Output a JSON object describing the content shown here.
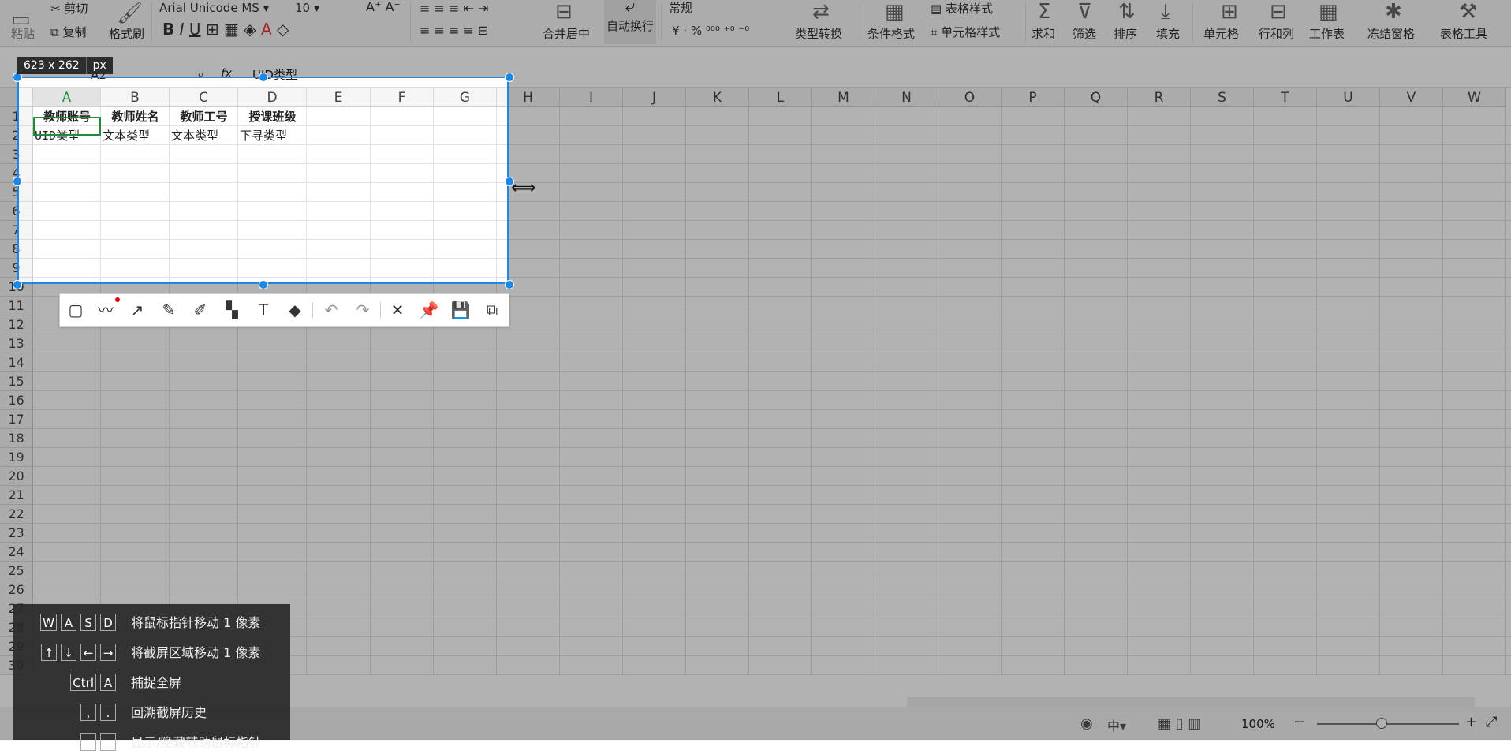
{
  "ribbon": {
    "clipboard": {
      "cut": "剪切",
      "copy": "复制",
      "paste": "粘贴",
      "format_painter": "格式刷"
    },
    "font": {
      "name": "Arial Unicode MS",
      "size": "10"
    },
    "alignment": {
      "merge": "合并居中",
      "wrap": "自动换行"
    },
    "number": {
      "format": "常规",
      "convert": "类型转换"
    },
    "styles": {
      "table_style": "表格样式",
      "cell_style": "单元格样式",
      "conditional": "条件格式"
    },
    "editing": {
      "sum": "求和",
      "filter": "筛选",
      "sort": "排序",
      "fill": "填充"
    },
    "cells": {
      "cell": "单元格",
      "rowcol": "行和列",
      "sheet": "工作表",
      "freeze": "冻结窗格",
      "tools": "表格工具"
    }
  },
  "formula_bar": {
    "name_box": "A2",
    "fx": "fx",
    "content": "UID类型"
  },
  "sheet": {
    "columns": [
      "A",
      "B",
      "C",
      "D",
      "E",
      "F",
      "G",
      "H",
      "I",
      "J",
      "K",
      "L",
      "M",
      "N",
      "O",
      "P",
      "Q",
      "R",
      "S",
      "T",
      "U",
      "V",
      "W"
    ],
    "rows": [
      "1",
      "2",
      "3",
      "4",
      "5",
      "6",
      "7",
      "8",
      "9",
      "10",
      "11",
      "12",
      "13",
      "14",
      "15",
      "16",
      "17",
      "18",
      "19",
      "20",
      "21",
      "22",
      "23",
      "24",
      "25",
      "26",
      "27",
      "28",
      "29",
      "30"
    ],
    "row1": [
      "教师账号",
      "教师姓名",
      "教师工号",
      "授课班级"
    ],
    "row2": [
      "UID类型",
      "文本类型",
      "文本类型",
      "下寻类型"
    ]
  },
  "capture": {
    "size_value": "623 x 262",
    "size_unit": "px"
  },
  "toolbar": {
    "tools": [
      "rectangle-icon",
      "polyline-icon",
      "arrow-icon",
      "pencil-icon",
      "highlighter-icon",
      "mosaic-icon",
      "text-icon",
      "eraser-icon",
      "undo-icon",
      "redo-icon",
      "close-icon",
      "pin-icon",
      "save-icon",
      "copy-icon"
    ]
  },
  "help": {
    "items": [
      {
        "keys": [
          "W",
          "A",
          "S",
          "D"
        ],
        "text": "将鼠标指针移动 1 像素"
      },
      {
        "keys": [
          "↑",
          "↓",
          "←",
          "→"
        ],
        "text": "将截屏区域移动 1 像素"
      },
      {
        "keys": [
          "Ctrl",
          "A"
        ],
        "text": "捕捉全屏"
      },
      {
        "keys": [
          ",",
          "."
        ],
        "text": "回溯截屏历史"
      },
      {
        "keys": [
          "↗",
          "↙"
        ],
        "text": "显示/隐藏辅助鼠标指针"
      }
    ]
  },
  "status": {
    "zoom": "100%"
  }
}
